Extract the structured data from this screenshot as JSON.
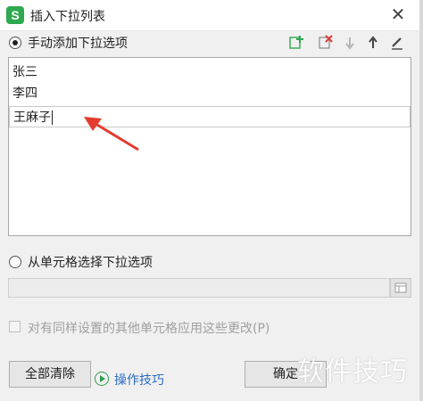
{
  "window": {
    "title": "插入下拉列表",
    "app_icon_letter": "S",
    "close_glyph": "✕"
  },
  "manual_option": {
    "label": "手动添加下拉选项",
    "selected": true
  },
  "toolbar": {
    "icons": [
      "add-icon",
      "delete-icon",
      "move-down-icon",
      "move-up-icon",
      "edit-icon"
    ]
  },
  "items": [
    "张三",
    "李四",
    "王麻子"
  ],
  "cell_option": {
    "label": "从单元格选择下拉选项",
    "selected": false
  },
  "apply_checkbox": {
    "label": "对有同样设置的其他单元格应用这些更改(P)",
    "checked": false
  },
  "buttons": {
    "clear_all": "全部清除",
    "tips": "操作技巧",
    "ok": "确定"
  },
  "watermark": "软件技巧",
  "colors": {
    "accent_green": "#2fa84f",
    "delete_red": "#e03a3a",
    "link_blue": "#2b6cc4",
    "arrow_red": "#e33b2e"
  }
}
